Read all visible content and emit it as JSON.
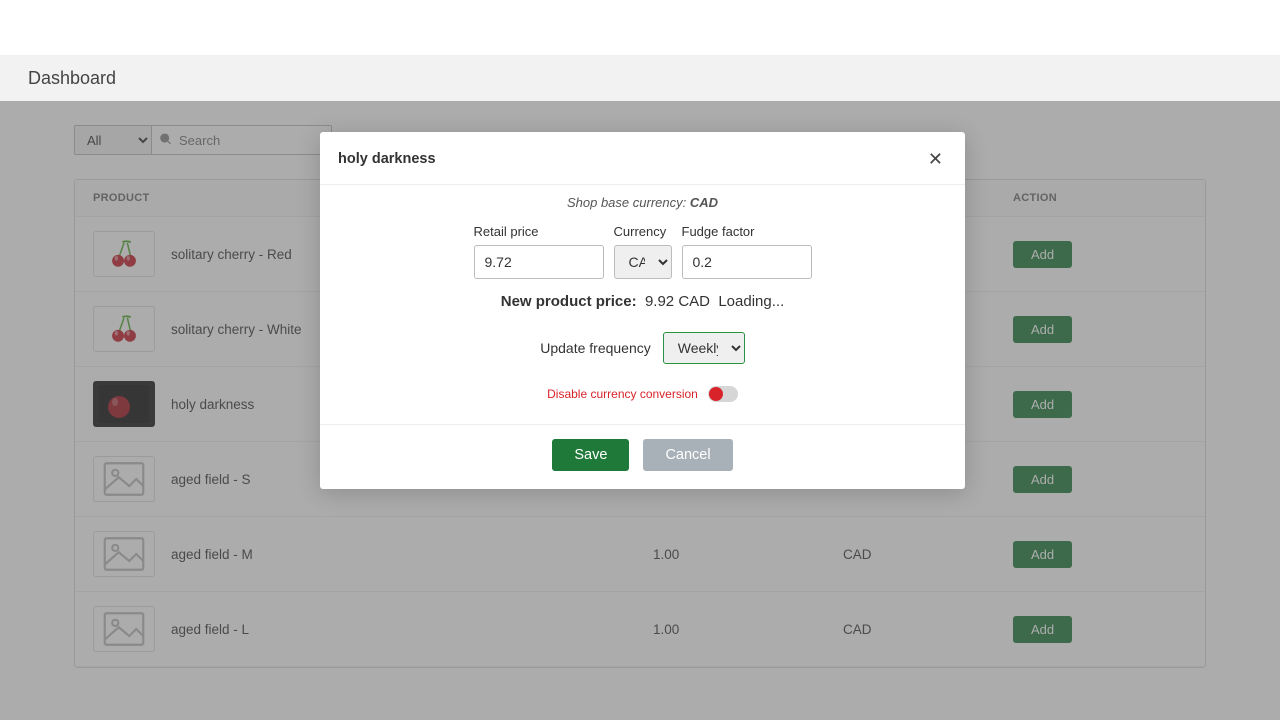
{
  "page_title": "Dashboard",
  "filter": {
    "select_value": "All",
    "search_placeholder": "Search"
  },
  "table": {
    "headers": {
      "product": "PRODUCT",
      "action": "ACTION"
    },
    "add_label": "Add",
    "rows": [
      {
        "name": "solitary cherry - Red",
        "price": "",
        "currency": "",
        "thumb": "cherry"
      },
      {
        "name": "solitary cherry - White",
        "price": "",
        "currency": "",
        "thumb": "cherry"
      },
      {
        "name": "holy darkness",
        "price": "",
        "currency": "",
        "thumb": "dark"
      },
      {
        "name": "aged field - S",
        "price": "1.00",
        "currency": "CAD",
        "thumb": "placeholder"
      },
      {
        "name": "aged field - M",
        "price": "1.00",
        "currency": "CAD",
        "thumb": "placeholder"
      },
      {
        "name": "aged field - L",
        "price": "1.00",
        "currency": "CAD",
        "thumb": "placeholder"
      }
    ]
  },
  "modal": {
    "title": "holy darkness",
    "base_currency_prefix": "Shop base currency: ",
    "base_currency_value": "CAD",
    "fields": {
      "retail_label": "Retail price",
      "retail_value": "9.72",
      "currency_label": "Currency",
      "currency_value": "CAD",
      "fudge_label": "Fudge factor",
      "fudge_value": "0.2"
    },
    "new_price_label": "New product price:",
    "new_price_value": "9.92 CAD",
    "loading_text": "Loading...",
    "frequency_label": "Update frequency",
    "frequency_value": "Weekly",
    "disable_label": "Disable currency conversion",
    "save_label": "Save",
    "cancel_label": "Cancel"
  }
}
